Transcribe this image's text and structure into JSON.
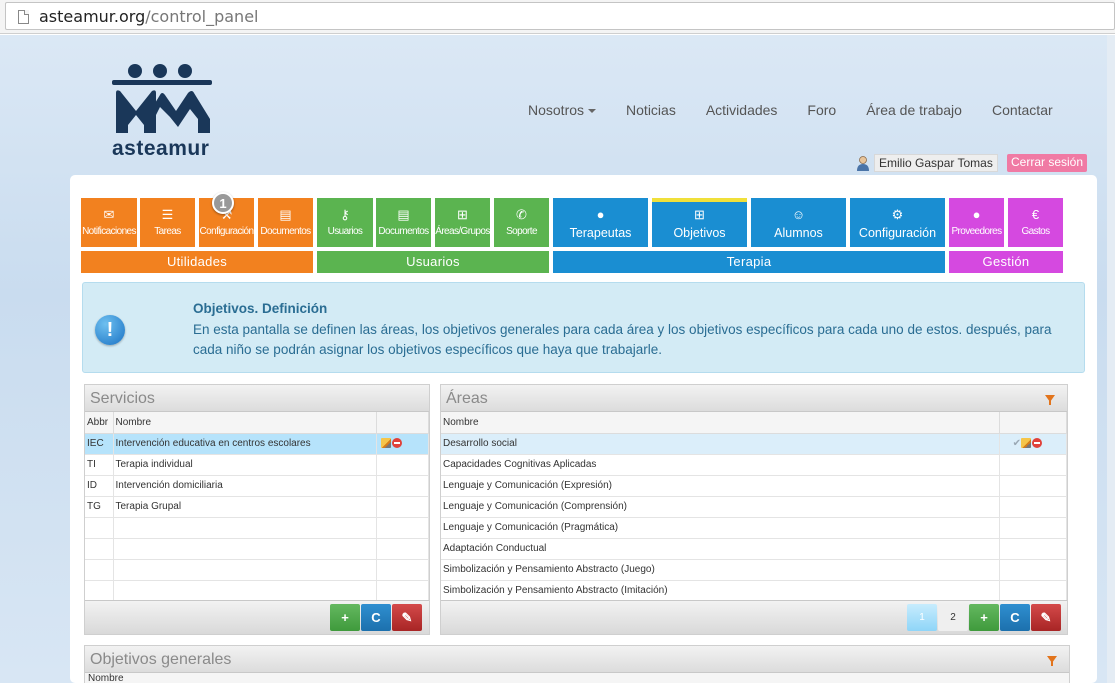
{
  "browser": {
    "url_domain": "asteamur.org",
    "url_path": "/control_panel"
  },
  "site": {
    "logo_text": "asteamur"
  },
  "nav": {
    "items": [
      {
        "label": "Nosotros",
        "dropdown": true
      },
      {
        "label": "Noticias"
      },
      {
        "label": "Actividades"
      },
      {
        "label": "Foro"
      },
      {
        "label": "Área de trabajo"
      },
      {
        "label": "Contactar"
      }
    ]
  },
  "user": {
    "name": "Emilio Gaspar Tomas",
    "logout_label": "Cerrar sesión"
  },
  "tiles": {
    "utilidades": [
      {
        "label": "Notificaciones",
        "icon": "envelope-icon"
      },
      {
        "label": "Tareas",
        "icon": "list-icon"
      },
      {
        "label": "Configuración",
        "icon": "wrench-icon",
        "badge": "1"
      },
      {
        "label": "Documentos",
        "icon": "document-icon"
      }
    ],
    "usuarios": [
      {
        "label": "Usuarios",
        "icon": "key-icon"
      },
      {
        "label": "Documentos",
        "icon": "document-icon"
      },
      {
        "label": "Áreas/Grupos",
        "icon": "sitemap-icon"
      },
      {
        "label": "Soporte",
        "icon": "chat-icon"
      }
    ],
    "terapia": [
      {
        "label": "Terapeutas",
        "icon": "user-icon"
      },
      {
        "label": "Objetivos",
        "icon": "sitemap-icon",
        "active": true
      },
      {
        "label": "Alumnos",
        "icon": "smile-icon"
      },
      {
        "label": "Configuración",
        "icon": "gears-icon"
      }
    ],
    "gestion": [
      {
        "label": "Proveedores",
        "icon": "user-icon"
      },
      {
        "label": "Gastos",
        "icon": "euro-icon"
      }
    ]
  },
  "groups": {
    "utilidades": "Utilidades",
    "usuarios": "Usuarios",
    "terapia": "Terapia",
    "gestion": "Gestión"
  },
  "info": {
    "title": "Objetivos. Definición",
    "text": "En esta pantalla se definen las áreas, los objetivos generales para cada área y los objetivos específicos para cada uno de estos. después, para cada niño se podrán asignar los objetivos específicos que haya que trabajarle."
  },
  "servicios": {
    "title": "Servicios",
    "columns": [
      "Abbr",
      "Nombre"
    ],
    "rows": [
      {
        "abbr": "IEC",
        "nombre": "Intervención educativa en centros escolares"
      },
      {
        "abbr": "TI",
        "nombre": "Terapia individual"
      },
      {
        "abbr": "ID",
        "nombre": "Intervención domiciliaria"
      },
      {
        "abbr": "TG",
        "nombre": "Terapia Grupal"
      }
    ]
  },
  "areas": {
    "title": "Áreas",
    "columns": [
      "Nombre"
    ],
    "rows": [
      "Desarrollo social",
      "Capacidades Cognitivas Aplicadas",
      "Lenguaje y Comunicación (Expresión)",
      "Lenguaje y Comunicación (Comprensión)",
      "Lenguaje y Comunicación (Pragmática)",
      "Adaptación Conductual",
      "Simbolización y Pensamiento Abstracto (Juego)",
      "Simbolización y Pensamiento Abstracto (Imitación)"
    ],
    "pages": [
      "1",
      "2"
    ]
  },
  "objetivos": {
    "title": "Objetivos generales",
    "column": "Nombre"
  },
  "buttons": {
    "add": "+",
    "refresh": "C",
    "config": "✎"
  },
  "colors": {
    "utilidades": "#f2811f",
    "usuarios": "#5bb450",
    "terapia": "#1a8ed2",
    "gestion": "#d549e0"
  }
}
